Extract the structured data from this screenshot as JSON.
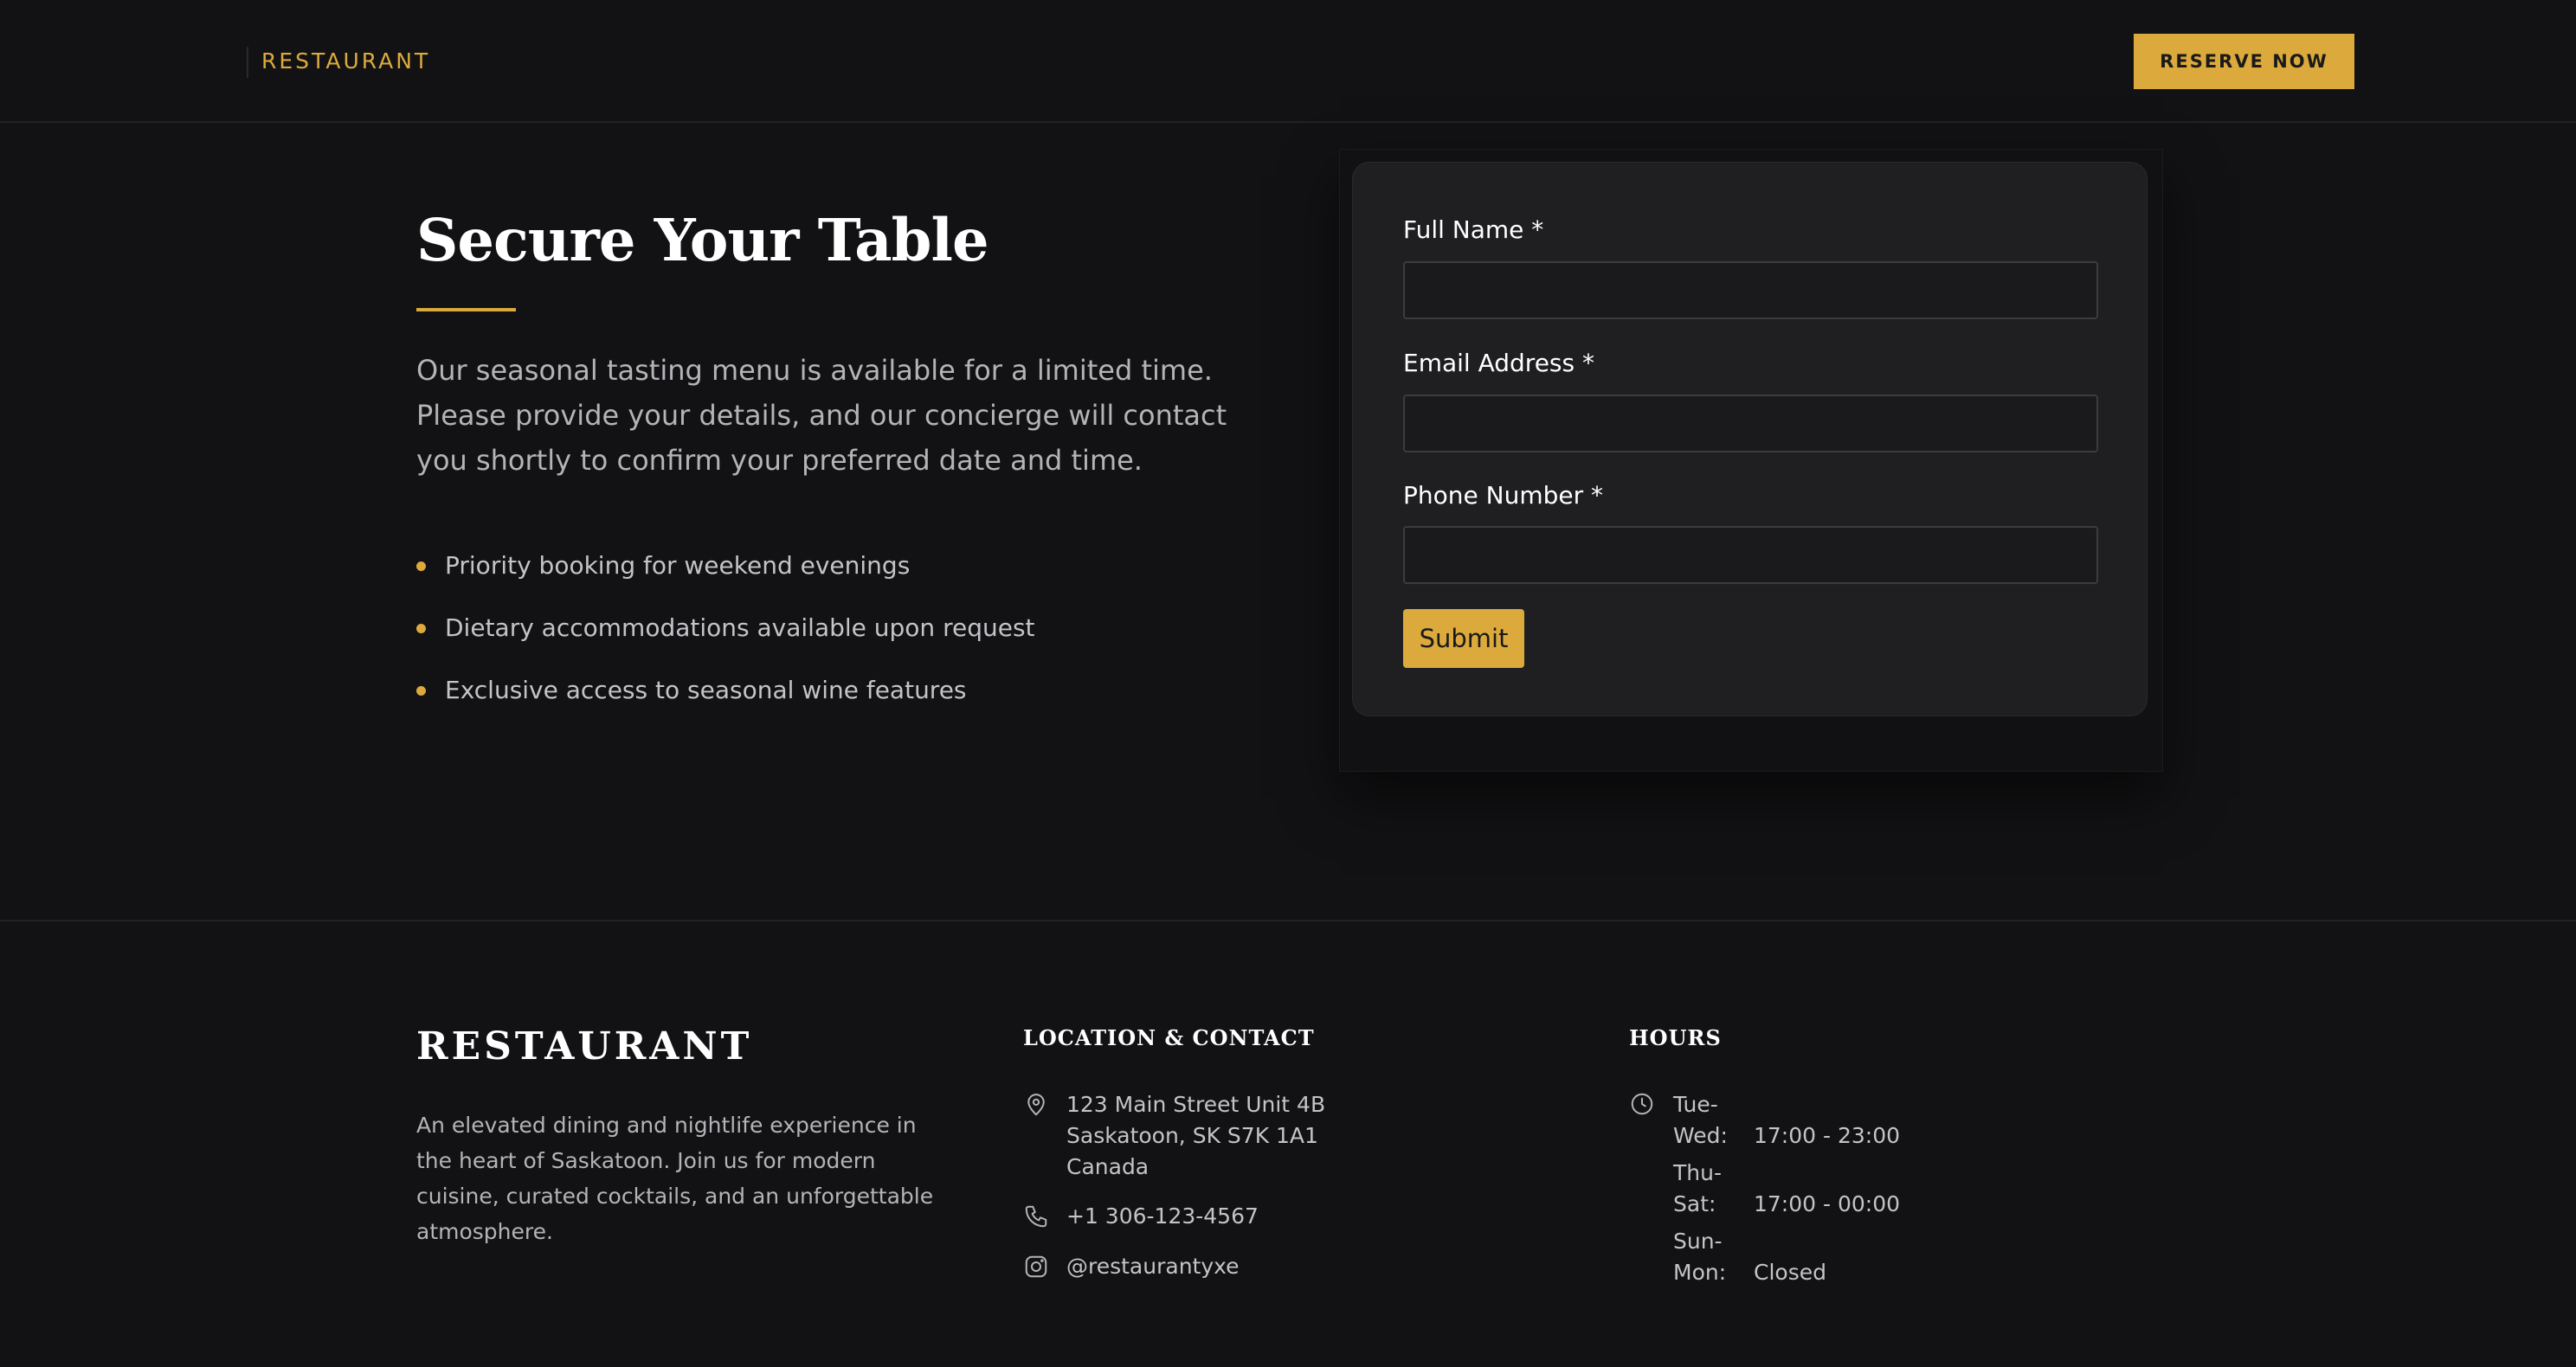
{
  "header": {
    "brand": "RESTAURANT",
    "reserve_label": "RESERVE NOW"
  },
  "intro": {
    "title": "Secure Your Table",
    "description": "Our seasonal tasting menu is available for a limited time. Please provide your details, and our concierge will contact you shortly to confirm your preferred date and time.",
    "features": [
      "Priority booking for weekend evenings",
      "Dietary accommodations available upon request",
      "Exclusive access to seasonal wine features"
    ]
  },
  "form": {
    "full_name_label": "Full Name *",
    "full_name_value": "",
    "email_label": "Email Address *",
    "email_value": "",
    "phone_label": "Phone Number *",
    "phone_value": "",
    "submit_label": "Submit"
  },
  "footer": {
    "brand": "RESTAURANT",
    "description": "An elevated dining and nightlife experience in the heart of Saskatoon. Join us for modern cuisine, curated cocktails, and an unforgettable atmosphere.",
    "contact_heading": "LOCATION & CONTACT",
    "address_line1": "123 Main Street Unit 4B",
    "address_line2": "Saskatoon, SK S7K 1A1",
    "address_line3": "Canada",
    "phone": "+1 306-123-4567",
    "instagram": "@restaurantyxe",
    "hours_heading": "HOURS",
    "hours": [
      {
        "day": "Tue-Wed:",
        "time": "17:00 - 23:00"
      },
      {
        "day": "Thu-Sat:",
        "time": "17:00 - 00:00"
      },
      {
        "day": "Sun-Mon:",
        "time": "Closed"
      }
    ]
  },
  "colors": {
    "background": "#121214",
    "accent": "#dcaa3c",
    "card": "#1f1f21"
  },
  "icons": [
    "map-pin-icon",
    "phone-icon",
    "instagram-icon",
    "clock-icon"
  ]
}
